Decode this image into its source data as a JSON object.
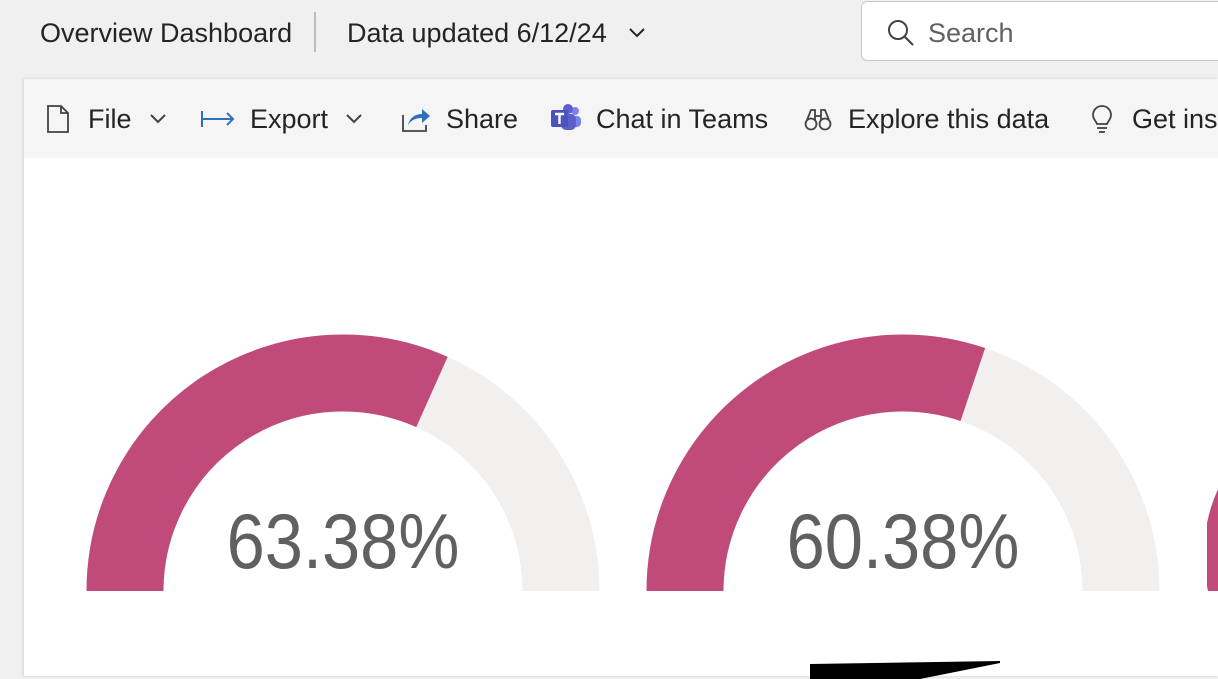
{
  "header": {
    "title": "Overview Dashboard",
    "updated_label": "Data updated 6/12/24",
    "search_placeholder": "Search"
  },
  "toolbar": {
    "items": [
      {
        "label": "File",
        "icon": "file-icon",
        "has_dropdown": true
      },
      {
        "label": "Export",
        "icon": "export-icon",
        "has_dropdown": true
      },
      {
        "label": "Share",
        "icon": "share-icon",
        "has_dropdown": false
      },
      {
        "label": "Chat in Teams",
        "icon": "teams-icon",
        "has_dropdown": false
      },
      {
        "label": "Explore this data",
        "icon": "binoculars-icon",
        "has_dropdown": false
      },
      {
        "label": "Get ins",
        "icon": "lightbulb-icon",
        "has_dropdown": false
      }
    ]
  },
  "gauges": [
    {
      "value_text": "63.38%",
      "value": 0.6338
    },
    {
      "value_text": "60.38%",
      "value": 0.6038
    }
  ],
  "colors": {
    "gauge_fill": "#c04a7a",
    "gauge_track": "#f1f0ef",
    "teams_purple": "#5b5fc7",
    "accent_blue": "#2f6fbf"
  }
}
